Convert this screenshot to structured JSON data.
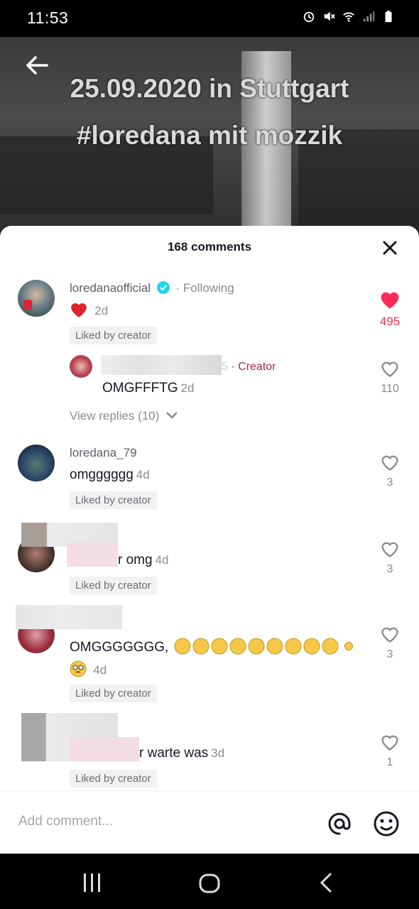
{
  "status": {
    "time": "11:53"
  },
  "video": {
    "line1": "25.09.2020 in Stuttgart",
    "line2": "#loredana mit mozzik"
  },
  "sheet": {
    "title": "168 comments"
  },
  "comments": [
    {
      "username": "loredanaofficial",
      "verified": true,
      "following": "· Following",
      "text": "",
      "time": "2d",
      "liked_by_creator": "Liked by creator",
      "likes": "495",
      "liked": true
    },
    {
      "reply": true,
      "creator_tag": "· Creator",
      "text": "OMGFFFTG",
      "time": "2d",
      "likes": "110"
    },
    {
      "view_replies": "View replies (10)"
    },
    {
      "username": "loredana_79",
      "text": "omgggggg",
      "time": "4d",
      "liked_by_creator": "Liked by creator",
      "likes": "3"
    },
    {
      "text": "r omg",
      "time": "4d",
      "liked_by_creator": "Liked by creator",
      "likes": "3"
    },
    {
      "text": "OMGGGGGGG,",
      "time": "4d",
      "liked_by_creator": "Liked by creator",
      "likes": "3"
    },
    {
      "text": "r warte was",
      "time": "3d",
      "liked_by_creator": "Liked by creator",
      "likes": "1"
    }
  ],
  "input": {
    "placeholder": "Add comment..."
  },
  "colors": {
    "accent": "#fe2c55",
    "creator": "#a3294e",
    "verified": "#20d5ec"
  }
}
